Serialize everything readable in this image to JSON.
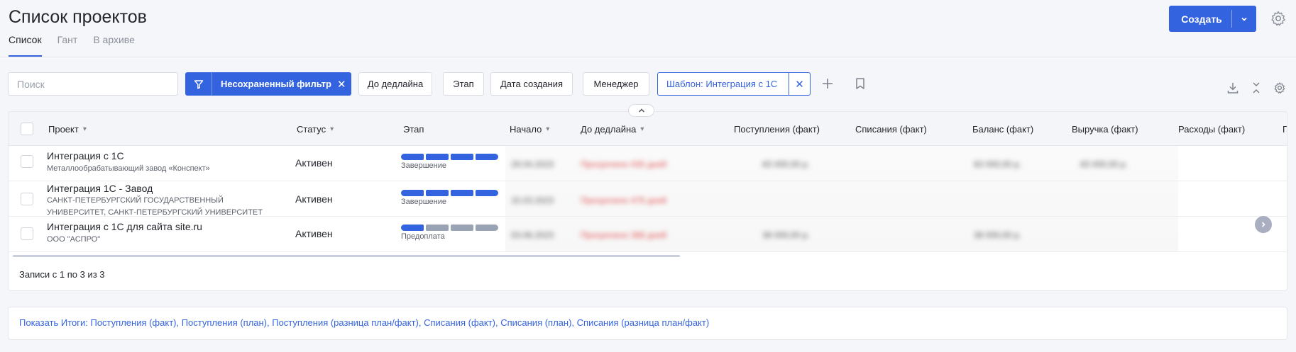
{
  "header": {
    "title": "Список проектов",
    "tabs": [
      {
        "label": "Список",
        "active": true
      },
      {
        "label": "Гант",
        "active": false
      },
      {
        "label": "В архиве",
        "active": false
      }
    ],
    "create_label": "Создать"
  },
  "filters": {
    "search_placeholder": "Поиск",
    "unsaved_filter": "Несохраненный фильтр",
    "chips": [
      "До дедлайна",
      "Этап",
      "Дата создания",
      "Менеджер"
    ],
    "template": "Шаблон: Интеграция с 1С"
  },
  "table": {
    "columns": [
      "Проект",
      "Статус",
      "Этап",
      "Начало",
      "До дедлайна",
      "Поступления (факт)",
      "Списания (факт)",
      "Баланс (факт)",
      "Выручка (факт)",
      "Расходы (факт)",
      "П"
    ],
    "rows": [
      {
        "name": "Интеграция с 1С",
        "company": "Металлообрабатывающий завод «Конспект»",
        "status": "Активен",
        "stage_label": "Завершение",
        "stage_filled": 4,
        "stage_total": 4,
        "start": "29.04.2023",
        "deadline": "Просрочено 435 дней",
        "income": "83 000,00 р.",
        "balance": "83 000,00 р.",
        "revenue": "83 000,00 р."
      },
      {
        "name": "Интеграция 1С - Завод",
        "company": "САНКТ-ПЕТЕРБУРГСКИЙ ГОСУДАРСТВЕННЫЙ УНИВЕРСИТЕТ, САНКТ-ПЕТЕРБУРГСКИЙ УНИВЕРСИТЕТ",
        "status": "Активен",
        "stage_label": "Завершение",
        "stage_filled": 4,
        "stage_total": 4,
        "start": "15.03.2023",
        "deadline": "Просрочено 476 дней"
      },
      {
        "name": "Интеграция с 1С для сайта site.ru",
        "company": "ООО \"АСПРО\"",
        "status": "Активен",
        "stage_label": "Предоплата",
        "stage_filled": 1,
        "stage_total": 4,
        "start": "03.06.2023",
        "deadline": "Просрочено 388 дней",
        "income": "38 000,00 р.",
        "balance": "38 000,00 р."
      }
    ],
    "records_info": "Записи с 1 по 3 из 3"
  },
  "totals": {
    "text": "Показать Итоги: Поступления (факт), Поступления (план), Поступления (разница план/факт), Списания (факт), Списания (план), Списания (разница план/факт)"
  },
  "colors": {
    "accent": "#3463e0",
    "stage_off": "#9aa3b3",
    "overdue": "#e04a4a"
  }
}
